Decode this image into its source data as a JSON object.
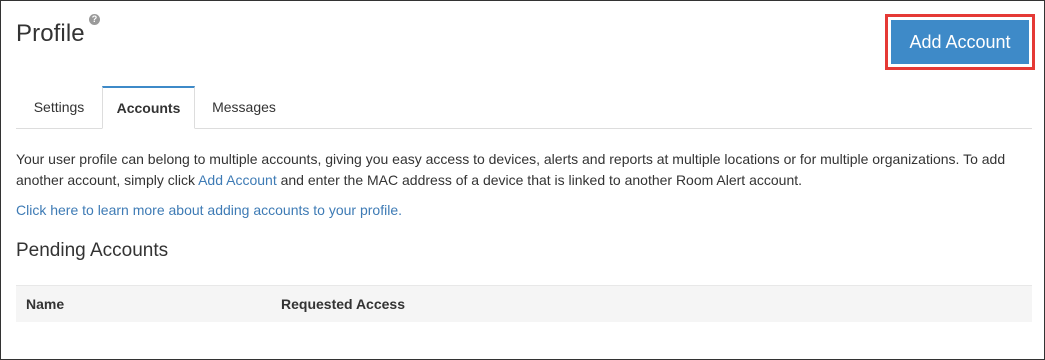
{
  "header": {
    "title": "Profile",
    "help_glyph": "?",
    "help_icon": "question-circle-icon",
    "add_account_label": "Add Account"
  },
  "tabs": [
    {
      "label": "Settings",
      "active": false
    },
    {
      "label": "Accounts",
      "active": true
    },
    {
      "label": "Messages",
      "active": false
    }
  ],
  "content": {
    "intro_part1": "Your user profile can belong to multiple accounts, giving you easy access to devices, alerts and reports at multiple locations or for multiple organizations. To add another account, simply click ",
    "intro_link": "Add Account",
    "intro_part2": " and enter the MAC address of a device that is linked to another Room Alert account.",
    "learn_more_link": "Click here to learn more about adding accounts to your profile.",
    "pending_title": "Pending Accounts",
    "table": {
      "columns": [
        "Name",
        "Requested Access"
      ],
      "rows": []
    }
  },
  "colors": {
    "accent": "#3e8ac8",
    "link": "#3e7bb5",
    "highlight": "#e53935"
  }
}
